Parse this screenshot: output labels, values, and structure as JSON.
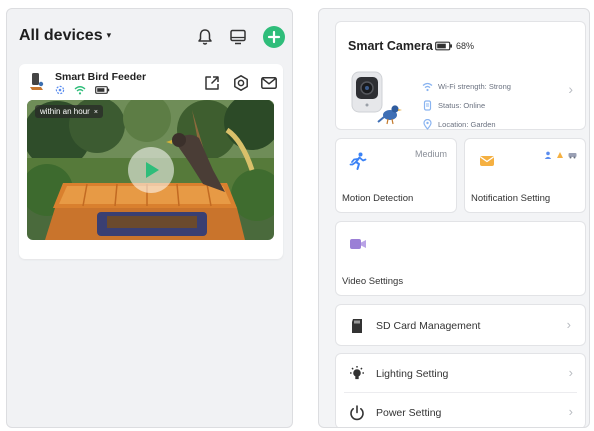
{
  "left": {
    "title": "All devices",
    "caret": "▾",
    "device": {
      "name": "Smart Bird Feeder",
      "video_tag": "within an hour",
      "video_tag_close": "×"
    }
  },
  "right": {
    "camera": {
      "title": "Smart Camera",
      "battery": "68%",
      "wifi": "Wi-Fi strength: Strong",
      "status": "Status: Online",
      "location": "Location: Garden",
      "chevron": "›"
    },
    "motion": {
      "label": "Motion Detection",
      "value": "Medium"
    },
    "notification": {
      "label": "Notification Setting"
    },
    "video": {
      "label": "Video Settings"
    },
    "sd": {
      "label": "SD Card Management",
      "chevron": "›"
    },
    "lighting": {
      "label": "Lighting Setting",
      "chevron": "›"
    },
    "power": {
      "label": "Power Setting",
      "chevron": "›"
    }
  },
  "colors": {
    "accent_green": "#2fbd7a",
    "icon_blue": "#5b8def",
    "motion_blue": "#3b82f6",
    "notify_orange": "#f5b041",
    "video_purple": "#9b7fd6"
  },
  "icons": {
    "header": [
      "bell-icon",
      "monitor-icon",
      "add-icon"
    ],
    "device_actions": [
      "share-icon",
      "settings-icon",
      "mail-icon"
    ],
    "device_status": [
      "motion-sensor-icon",
      "wifi-icon",
      "battery-icon"
    ],
    "rows": [
      "sd-card-icon",
      "light-bulb-icon",
      "power-icon"
    ]
  }
}
